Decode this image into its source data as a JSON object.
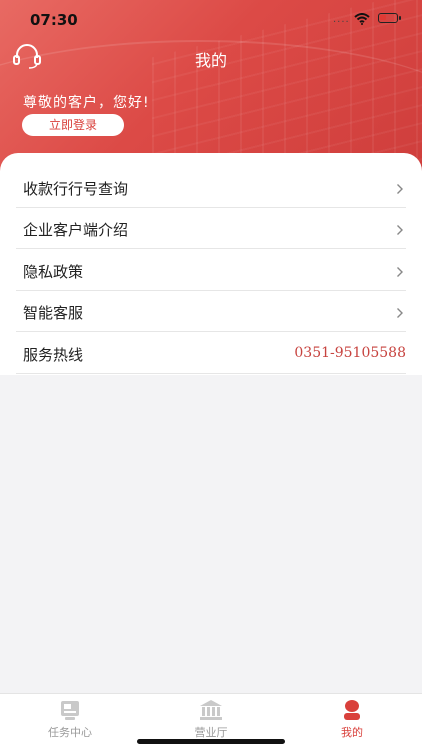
{
  "status_bar": {
    "time": "07:30",
    "signal": "····",
    "battery_level": 0.2
  },
  "header": {
    "title": "我的",
    "greeting": "尊敬的客户，您好!",
    "login_label": "立即登录",
    "accent": "#d9403b"
  },
  "menu": {
    "items": [
      {
        "label": "收款行行号查询"
      },
      {
        "label": "企业客户端介绍"
      },
      {
        "label": "隐私政策"
      },
      {
        "label": "智能客服"
      }
    ],
    "hotline": {
      "label": "服务热线",
      "value": "0351-95105588"
    }
  },
  "tabbar": {
    "tabs": [
      {
        "label": "任务中心",
        "icon": "task-center-icon"
      },
      {
        "label": "营业厅",
        "icon": "bank-icon"
      },
      {
        "label": "我的",
        "icon": "profile-icon",
        "active": true
      }
    ]
  }
}
